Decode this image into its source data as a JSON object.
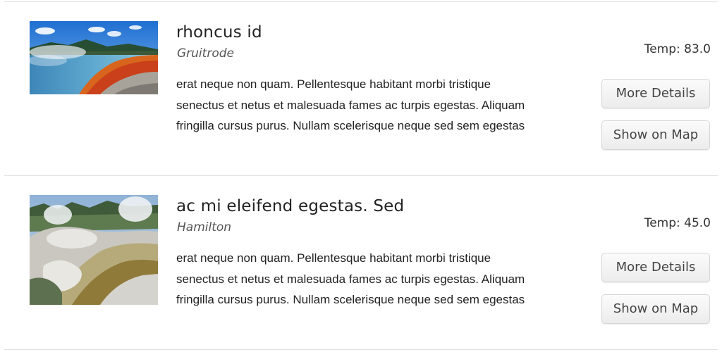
{
  "listings": [
    {
      "image_alt": "geothermal hot spring with orange mineral edges",
      "title": "rhoncus id",
      "location": "Gruitrode",
      "description": "erat neque non quam. Pellentesque habitant morbi tristique senectus et netus et malesuada fames ac turpis egestas. Aliquam fringilla cursus purus. Nullam scelerisque neque sed sem egestas",
      "temp_label": "Temp: 83.0",
      "more_details_label": "More Details",
      "show_on_map_label": "Show on Map"
    },
    {
      "image_alt": "steaming silica terraces",
      "title": "ac mi eleifend egestas. Sed",
      "location": "Hamilton",
      "description": "erat neque non quam. Pellentesque habitant morbi tristique senectus et netus et malesuada fames ac turpis egestas. Aliquam fringilla cursus purus. Nullam scelerisque neque sed sem egestas",
      "temp_label": "Temp: 45.0",
      "more_details_label": "More Details",
      "show_on_map_label": "Show on Map"
    }
  ]
}
